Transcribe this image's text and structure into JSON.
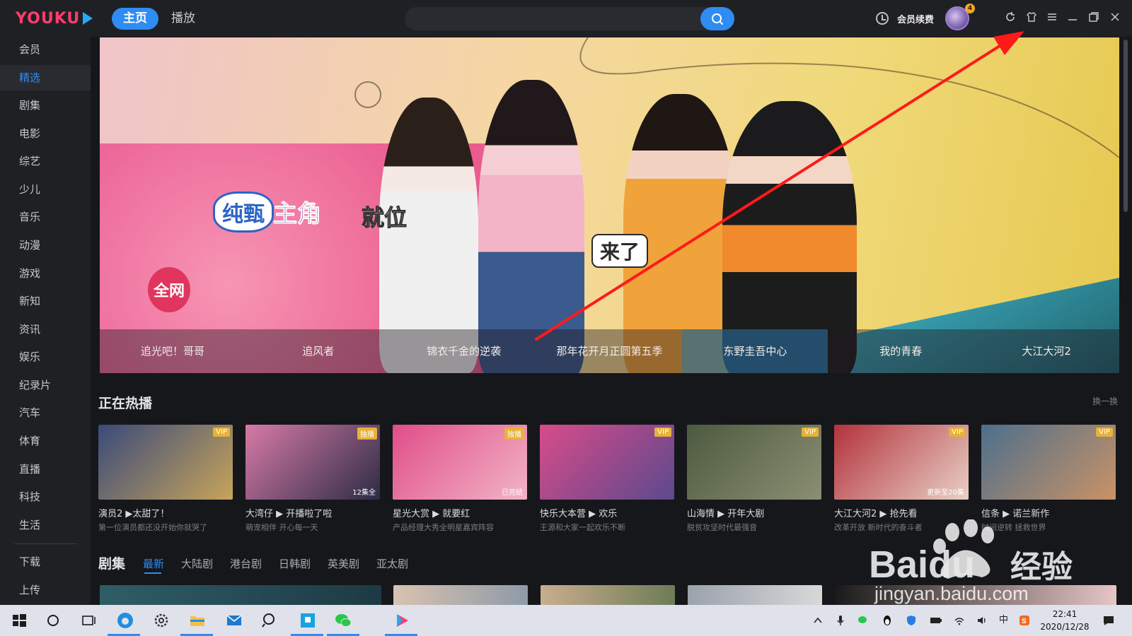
{
  "app": {
    "logo": "YOUKU",
    "nav_tabs": [
      {
        "label": "主页",
        "active": true
      },
      {
        "label": "播放",
        "active": false
      }
    ],
    "search": {
      "placeholder": ""
    },
    "vip_renew": "会员续费",
    "avatar_badge": "4",
    "window_controls": [
      "refresh-icon",
      "skin-icon",
      "menu-icon",
      "minimize-icon",
      "maximize-icon",
      "close-icon"
    ]
  },
  "sidebar": {
    "items": [
      {
        "label": "会员",
        "active": false
      },
      {
        "label": "精选",
        "active": true
      },
      {
        "label": "剧集",
        "active": false
      },
      {
        "label": "电影",
        "active": false
      },
      {
        "label": "综艺",
        "active": false
      },
      {
        "label": "少儿",
        "active": false
      },
      {
        "label": "音乐",
        "active": false
      },
      {
        "label": "动漫",
        "active": false
      },
      {
        "label": "游戏",
        "active": false
      },
      {
        "label": "新知",
        "active": false
      },
      {
        "label": "资讯",
        "active": false
      },
      {
        "label": "娱乐",
        "active": false
      },
      {
        "label": "纪录片",
        "active": false
      },
      {
        "label": "汽车",
        "active": false
      },
      {
        "label": "体育",
        "active": false
      },
      {
        "label": "直播",
        "active": false
      },
      {
        "label": "科技",
        "active": false
      },
      {
        "label": "生活",
        "active": false
      }
    ],
    "bottom_items": [
      "下载",
      "上传"
    ]
  },
  "banner": {
    "overlay_texts": [
      "纯甄",
      "主角",
      "就位",
      "来了",
      "全网"
    ],
    "tabs": [
      {
        "label": "追光吧！哥哥",
        "active": false
      },
      {
        "label": "追风者",
        "active": false
      },
      {
        "label": "锦衣千金的逆袭",
        "active": false
      },
      {
        "label": "那年花开月正圆第五季",
        "active": false
      },
      {
        "label": "东野圭吾中心",
        "active": true
      },
      {
        "label": "我的青春",
        "active": false
      },
      {
        "label": "大江大河2",
        "active": false
      }
    ]
  },
  "hot_section": {
    "title": "正在热播",
    "refresh": "换一换",
    "cards": [
      {
        "title": "演员2 ▶太甜了！",
        "subtitle": "第一位演员都还没开始你就哭了",
        "tag": "VIP",
        "ep": "",
        "colors": [
          "#3a4a7a",
          "#c7a45a"
        ]
      },
      {
        "title": "大湾仔 ▶ 开播啦了啦",
        "subtitle": "萌宠相伴 开心每一天",
        "tag": "独播",
        "ep": "12集全",
        "colors": [
          "#d77aa7",
          "#2c2c45"
        ]
      },
      {
        "title": "星光大赏 ▶ 就要红",
        "subtitle": "产品经理大秀全明星嘉宾阵容",
        "tag": "独播",
        "ep": "已完结",
        "colors": [
          "#e04d88",
          "#f2b4c6"
        ]
      },
      {
        "title": "快乐大本营 ▶ 欢乐",
        "subtitle": "王源和大家一起欢乐不断",
        "tag": "VIP",
        "ep": "",
        "colors": [
          "#d94b8a",
          "#5a4a8c"
        ]
      },
      {
        "title": "山海情 ▶ 开年大剧",
        "subtitle": "脱贫攻坚时代最强音",
        "tag": "VIP",
        "ep": "",
        "colors": [
          "#4d5a3f",
          "#8b8f73"
        ]
      },
      {
        "title": "大江大河2 ▶ 抢先看",
        "subtitle": "改革开放 新时代的奋斗者",
        "tag": "VIP",
        "ep": "更新至20集",
        "colors": [
          "#b3323c",
          "#e8d0c6"
        ]
      },
      {
        "title": "信条 ▶ 诺兰新作",
        "subtitle": "时间逆转 拯救世界",
        "tag": "VIP",
        "ep": "",
        "colors": [
          "#4d6f8c",
          "#c99266"
        ]
      }
    ]
  },
  "drama_section": {
    "title": "剧集",
    "tabs": [
      {
        "label": "最新",
        "active": true
      },
      {
        "label": "大陆剧",
        "active": false
      },
      {
        "label": "港台剧",
        "active": false
      },
      {
        "label": "日韩剧",
        "active": false
      },
      {
        "label": "英美剧",
        "active": false
      },
      {
        "label": "亚太剧",
        "active": false
      }
    ]
  },
  "watermark": {
    "brand": "Baidu",
    "suffix": "经验",
    "url": "jingyan.baidu.com"
  },
  "taskbar": {
    "time": "22:41",
    "date": "2020/12/28",
    "ime": "中"
  },
  "colors": {
    "accent": "#2e8cf3",
    "brand_pink": "#ff3d6c",
    "brand_blue": "#25a9f5",
    "annotation_arrow": "#ff1a1a"
  }
}
